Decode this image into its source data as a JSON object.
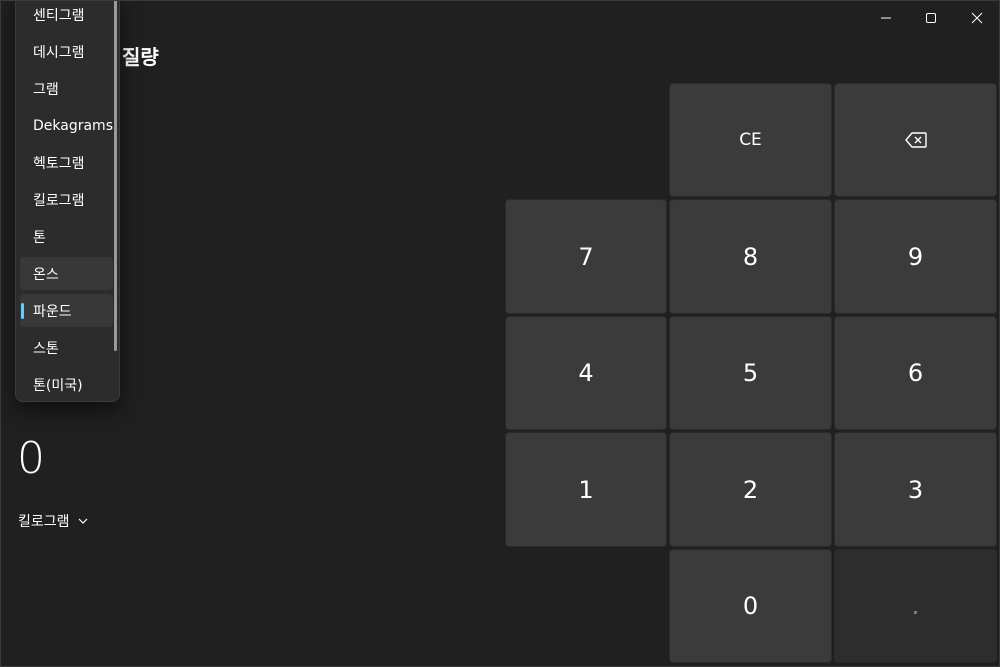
{
  "window_controls": {
    "minimize_icon": "minimize-icon",
    "maximize_icon": "maximize-icon",
    "close_icon": "close-icon"
  },
  "header": {
    "title": "질량"
  },
  "display": {
    "value": "0",
    "unit": "킬로그램"
  },
  "unit_dropdown": {
    "items": [
      {
        "label": "센티그램"
      },
      {
        "label": "데시그램"
      },
      {
        "label": "그램"
      },
      {
        "label": "Dekagrams"
      },
      {
        "label": "헥토그램"
      },
      {
        "label": "킬로그램"
      },
      {
        "label": "톤"
      },
      {
        "label": "온스"
      },
      {
        "label": "파운드"
      },
      {
        "label": "스톤"
      },
      {
        "label": "톤(미국)"
      }
    ],
    "selected": "파운드",
    "hovered": "온스",
    "accent_color": "#60cdff"
  },
  "keypad": {
    "ce": "CE",
    "backspace_icon": "backspace-icon",
    "seven": "7",
    "eight": "8",
    "nine": "9",
    "four": "4",
    "five": "5",
    "six": "6",
    "one": "1",
    "two": "2",
    "three": "3",
    "zero": "0",
    "decimal": "."
  }
}
